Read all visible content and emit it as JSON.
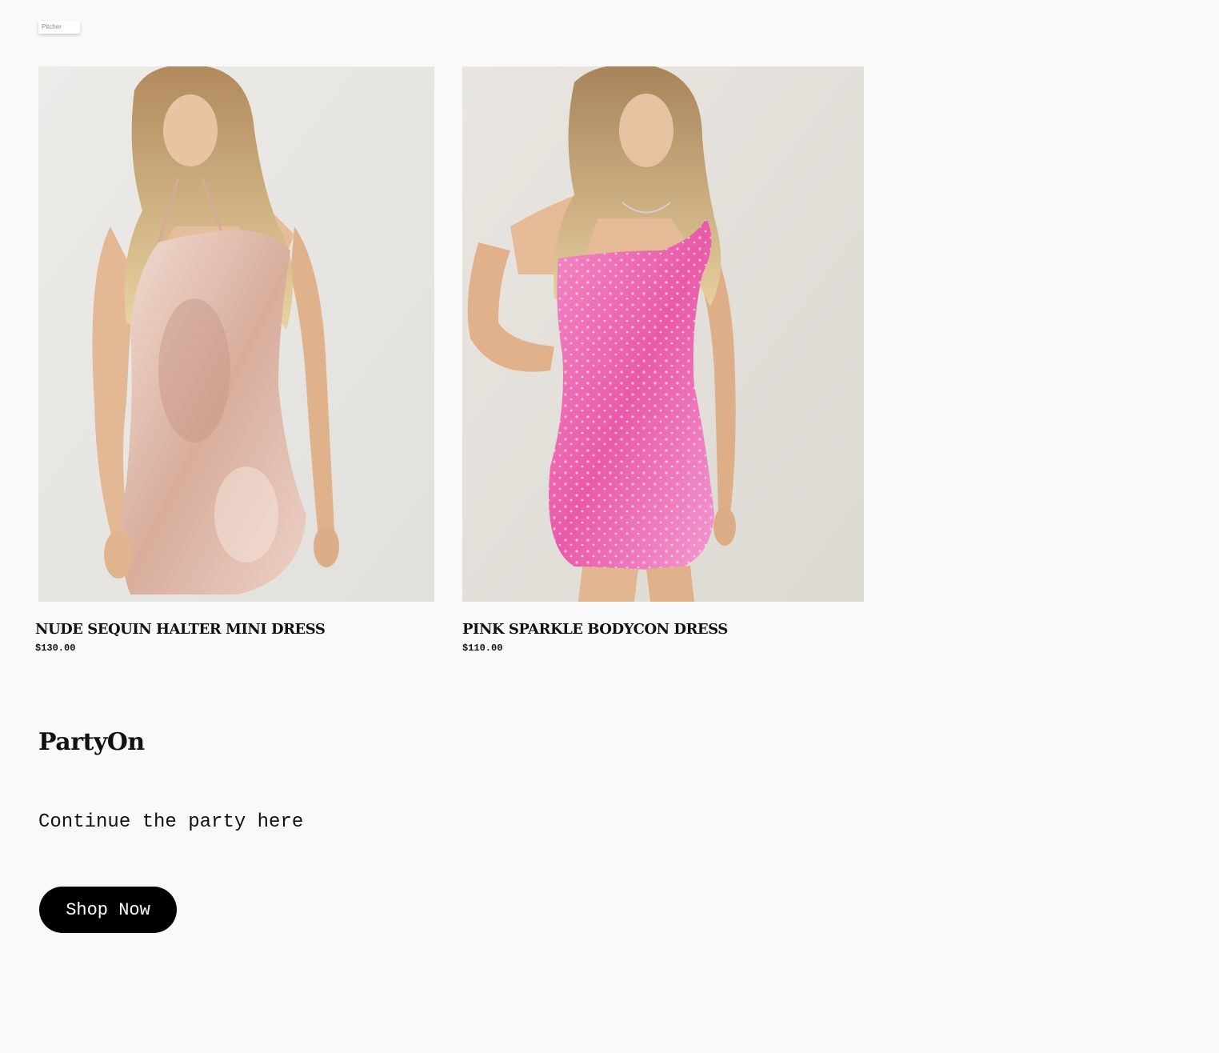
{
  "popup": {
    "text": "Pitcher"
  },
  "products": [
    {
      "name": "NUDE SEQUIN HALTER MINI DRESS",
      "price": "$130.00",
      "image_icon": "nude-sequin-dress-photo",
      "dress_color": "#e9c9bd"
    },
    {
      "name": "PINK SPARKLE BODYCON DRESS",
      "price": "$110.00",
      "image_icon": "pink-sparkle-dress-photo",
      "dress_color": "#ec6fb6"
    }
  ],
  "promo": {
    "brand": "PartyOn",
    "subtitle": "Continue the party here",
    "button_label": "Shop Now"
  },
  "colors": {
    "page_background": "#f9f9f9",
    "button_background": "#000000",
    "button_text": "#ffffff"
  }
}
